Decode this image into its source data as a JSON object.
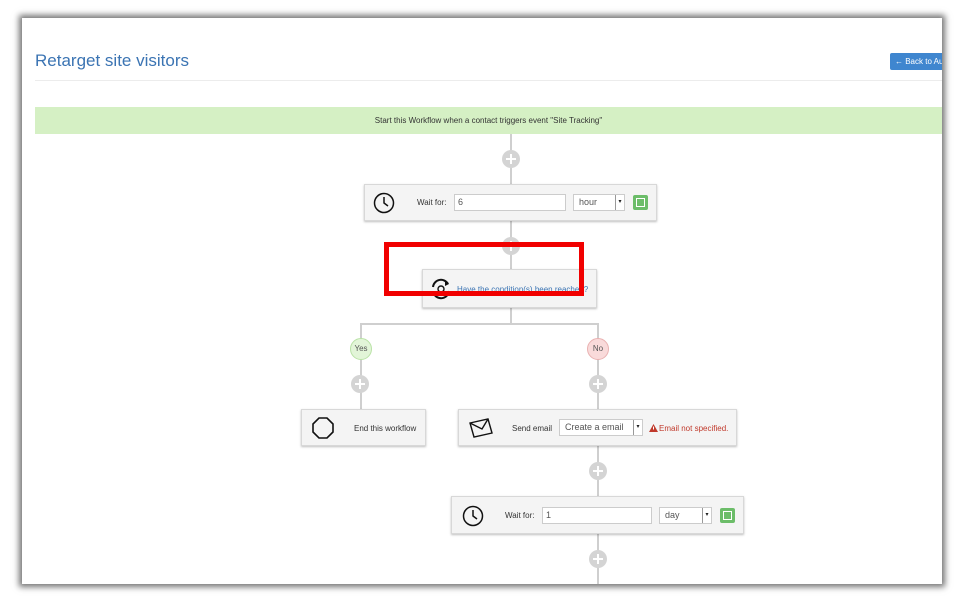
{
  "page": {
    "title": "Retarget site visitors",
    "back_button": "← Back to Au"
  },
  "trigger": {
    "text": "Start this Workflow when a contact triggers event \"Site Tracking\""
  },
  "wait_step_1": {
    "label": "Wait for:",
    "value": "6",
    "unit": "hour"
  },
  "condition_step": {
    "label": "Have the condition(s) been reached?"
  },
  "branches": {
    "yes": "Yes",
    "no": "No"
  },
  "end_step": {
    "label": "End this workflow"
  },
  "email_step": {
    "label": "Send email",
    "select": "Create a email",
    "error": "Email not specified."
  },
  "wait_step_2": {
    "label": "Wait for:",
    "value": "1",
    "unit": "day"
  },
  "colors": {
    "title": "#3b74b3",
    "trigger_bg": "#d5f0c4",
    "highlight": "#f10000",
    "save": "#6cbd69",
    "error": "#c0392b",
    "yes_bg": "#e2f5d8",
    "no_bg": "#f9dada"
  },
  "icons": [
    "clock-icon",
    "refresh-icon",
    "stop-icon",
    "envelope-icon",
    "save-icon",
    "plus-icon",
    "warning-icon",
    "arrow-left-icon"
  ]
}
